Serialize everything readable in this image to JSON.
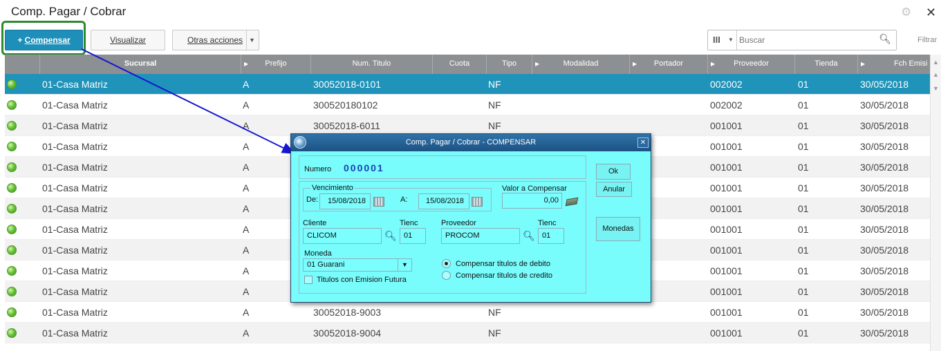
{
  "page": {
    "title": "Comp. Pagar / Cobrar"
  },
  "toolbar": {
    "compensar_label": "Compensar",
    "visualizar_label": "Visualizar",
    "otras_label": "Otras acciones",
    "search_placeholder": "Buscar",
    "filtrar_label": "Filtrar"
  },
  "grid": {
    "columns": [
      "Sucursal",
      "Prefijo",
      "Num. Titulo",
      "Cuota",
      "Tipo",
      "Modalidad",
      "Portador",
      "Proveedor",
      "Tienda",
      "Fch Emisi"
    ],
    "rows": [
      {
        "sucursal": "01-Casa Matriz",
        "prefijo": "A",
        "num": "30052018-0101",
        "tipo": "NF",
        "proveedor": "002002",
        "tienda": "01",
        "fecha": "30/05/2018"
      },
      {
        "sucursal": "01-Casa Matriz",
        "prefijo": "A",
        "num": "300520180102",
        "tipo": "NF",
        "proveedor": "002002",
        "tienda": "01",
        "fecha": "30/05/2018"
      },
      {
        "sucursal": "01-Casa Matriz",
        "prefijo": "A",
        "num": "30052018-6011",
        "tipo": "NF",
        "proveedor": "001001",
        "tienda": "01",
        "fecha": "30/05/2018"
      },
      {
        "sucursal": "01-Casa Matriz",
        "prefijo": "A",
        "num": "",
        "tipo": "",
        "proveedor": "001001",
        "tienda": "01",
        "fecha": "30/05/2018"
      },
      {
        "sucursal": "01-Casa Matriz",
        "prefijo": "A",
        "num": "",
        "tipo": "",
        "proveedor": "001001",
        "tienda": "01",
        "fecha": "30/05/2018"
      },
      {
        "sucursal": "01-Casa Matriz",
        "prefijo": "A",
        "num": "",
        "tipo": "",
        "proveedor": "001001",
        "tienda": "01",
        "fecha": "30/05/2018"
      },
      {
        "sucursal": "01-Casa Matriz",
        "prefijo": "A",
        "num": "",
        "tipo": "",
        "proveedor": "001001",
        "tienda": "01",
        "fecha": "30/05/2018"
      },
      {
        "sucursal": "01-Casa Matriz",
        "prefijo": "A",
        "num": "",
        "tipo": "",
        "proveedor": "001001",
        "tienda": "01",
        "fecha": "30/05/2018"
      },
      {
        "sucursal": "01-Casa Matriz",
        "prefijo": "A",
        "num": "",
        "tipo": "",
        "proveedor": "001001",
        "tienda": "01",
        "fecha": "30/05/2018"
      },
      {
        "sucursal": "01-Casa Matriz",
        "prefijo": "A",
        "num": "",
        "tipo": "",
        "proveedor": "001001",
        "tienda": "01",
        "fecha": "30/05/2018"
      },
      {
        "sucursal": "01-Casa Matriz",
        "prefijo": "A",
        "num": "",
        "tipo": "",
        "proveedor": "001001",
        "tienda": "01",
        "fecha": "30/05/2018"
      },
      {
        "sucursal": "01-Casa Matriz",
        "prefijo": "A",
        "num": "30052018-9003",
        "tipo": "NF",
        "proveedor": "001001",
        "tienda": "01",
        "fecha": "30/05/2018"
      },
      {
        "sucursal": "01-Casa Matriz",
        "prefijo": "A",
        "num": "30052018-9004",
        "tipo": "NF",
        "proveedor": "001001",
        "tienda": "01",
        "fecha": "30/05/2018"
      }
    ]
  },
  "dialog": {
    "title": "Comp. Pagar / Cobrar - COMPENSAR",
    "numero_label": "Numero",
    "numero_value": "000001",
    "vencimiento_label": "Vencimiento",
    "de_label": "De:",
    "de_value": "15/08/2018",
    "a_label": "A:",
    "a_value": "15/08/2018",
    "valor_label": "Valor a Compensar",
    "valor_value": "0,00",
    "cliente_label": "Cliente",
    "cliente_value": "CLICOM",
    "tienda_label": "Tienc",
    "tienda_cliente_value": "01",
    "proveedor_label": "Proveedor",
    "proveedor_value": "PROCOM",
    "tienda2_label": "Tienc",
    "tienda_proveedor_value": "01",
    "moneda_label": "Moneda",
    "moneda_value": "01 Guarani",
    "futura_label": "Titulos con Emision Futura",
    "debito_label": "Compensar titulos de debito",
    "credito_label": "Compensar titulos de credito",
    "ok_label": "Ok",
    "anular_label": "Anular",
    "monedas_label": "Monedas"
  }
}
